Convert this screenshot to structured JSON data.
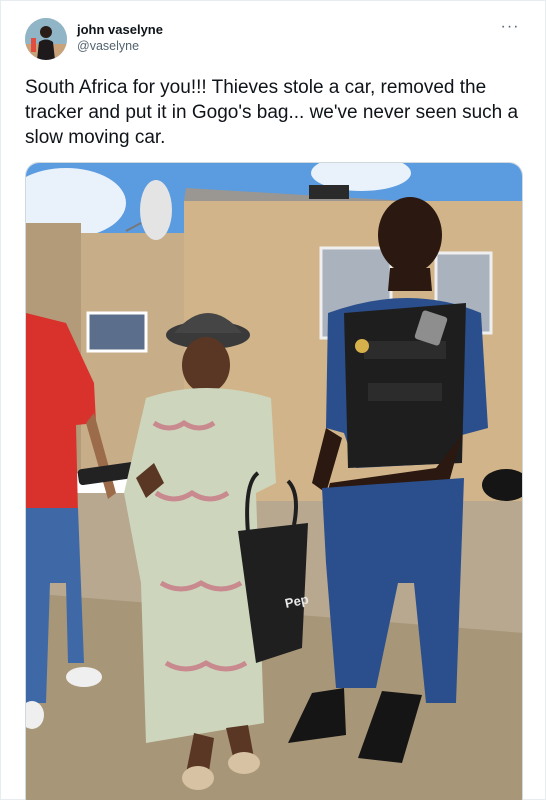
{
  "tweet": {
    "author": {
      "display_name": "john vaselyne",
      "handle": "@vaselyne"
    },
    "more_label": "···",
    "text": "South Africa for you!!! Thieves stole a car, removed the tracker and put it in Gogo's bag... we've never seen such a slow moving car.",
    "media": {
      "bag_lettering": "Pep"
    }
  },
  "colors": {
    "text_primary": "#0f1419",
    "text_secondary": "#536471",
    "border": "#e6ecf0",
    "sky": "#5b9be0",
    "police_blue": "#2b4f8c"
  }
}
